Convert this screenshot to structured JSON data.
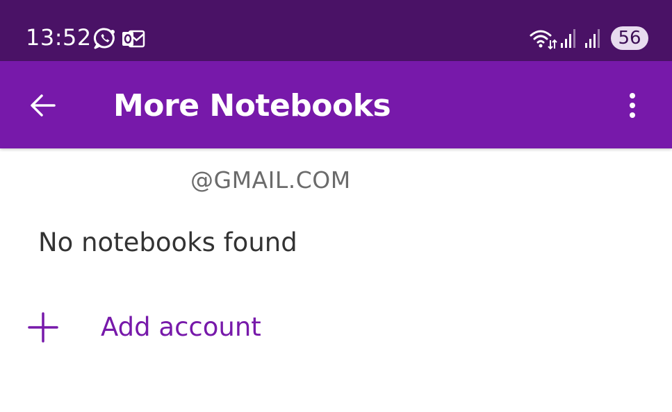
{
  "status_bar": {
    "time": "13:52",
    "battery": "56",
    "icons": [
      "whatsapp-icon",
      "outlook-icon",
      "wifi-icon",
      "signal-icon",
      "signal-icon"
    ]
  },
  "app_bar": {
    "title": "More Notebooks",
    "back_icon": "arrow-left-icon",
    "overflow_icon": "more-vertical-icon"
  },
  "account": {
    "email": "@GMAIL.COM",
    "empty_message": "No notebooks found"
  },
  "add_account": {
    "label": "Add account",
    "icon": "plus-icon"
  },
  "colors": {
    "status_bar": "#4a1266",
    "app_bar": "#7719aa",
    "accent": "#7719aa"
  }
}
